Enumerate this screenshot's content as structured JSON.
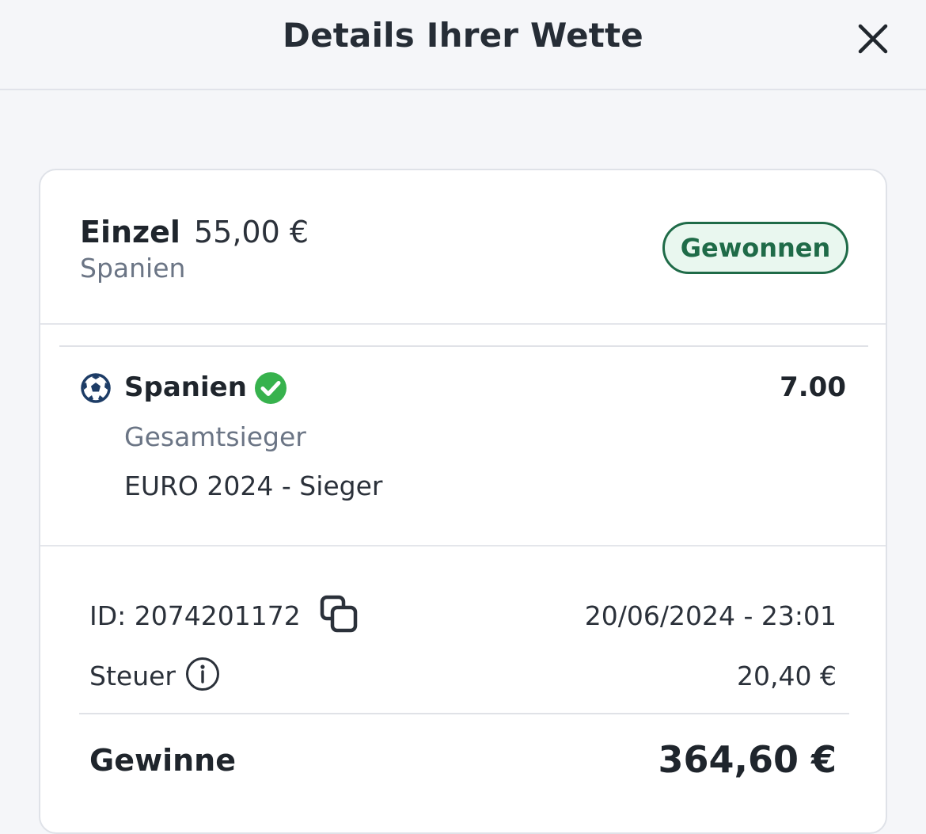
{
  "header": {
    "title": "Details Ihrer Wette",
    "close_icon": "close-icon"
  },
  "summary": {
    "bet_type": "Einzel",
    "stake": "55,00 €",
    "selection": "Spanien",
    "status": "Gewonnen",
    "status_color": "#1f6b48",
    "status_bg": "#e9f7ef"
  },
  "selection": {
    "sport_icon": "soccer-ball-icon",
    "name": "Spanien",
    "result_icon": "check-circle-icon",
    "result_color": "#37b24d",
    "odds": "7.00",
    "market": "Gesamtsieger",
    "event": "EURO 2024 - Sieger"
  },
  "info": {
    "id_label": "ID: 2074201172",
    "copy_icon": "copy-icon",
    "datetime": "20/06/2024 - 23:01",
    "tax_label": "Steuer",
    "tax_info_icon": "info-icon",
    "tax_value": "20,40 €",
    "winnings_label": "Gewinne",
    "winnings_value": "364,60 €"
  }
}
